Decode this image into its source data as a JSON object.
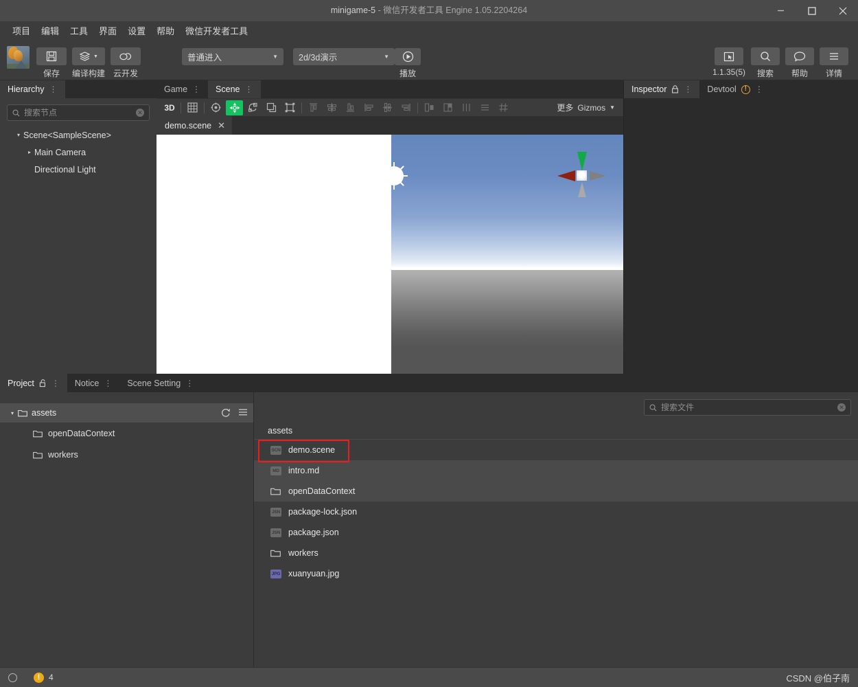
{
  "window": {
    "title_main": "minigame-5",
    "title_sep": "-",
    "title_sub": "微信开发者工具",
    "title_engine": "Engine 1.05.2204264",
    "minimize": "minimize-icon",
    "maximize": "maximize-icon",
    "close": "close-icon"
  },
  "menubar": {
    "items": [
      {
        "label": "项目"
      },
      {
        "label": "编辑"
      },
      {
        "label": "工具"
      },
      {
        "label": "界面"
      },
      {
        "label": "设置"
      },
      {
        "label": "帮助"
      },
      {
        "label": "微信开发者工具"
      }
    ]
  },
  "toolbar": {
    "project_thumb": "project-thumbnail",
    "save_label": "保存",
    "build_label": "编译构建",
    "cloud_label": "云开发",
    "enter_mode": "普通进入",
    "demo_mode": "2d/3d演示",
    "play_label": "播放",
    "version_label": "1.1.35(5)",
    "search_label": "搜索",
    "help_label": "帮助",
    "detail_label": "详情"
  },
  "hierarchy": {
    "tab_label": "Hierarchy",
    "search_placeholder": "搜索节点",
    "search_value": "",
    "nodes": [
      {
        "label": "Scene<SampleScene>",
        "depth": 0,
        "expanded": true,
        "arrow": "▾"
      },
      {
        "label": "Main Camera",
        "depth": 1,
        "expanded": false,
        "arrow": "▸"
      },
      {
        "label": "Directional Light",
        "depth": 1,
        "expanded": null,
        "arrow": ""
      }
    ]
  },
  "scene_panel": {
    "tabs": [
      {
        "label": "Game",
        "active": false
      },
      {
        "label": "Scene",
        "active": true
      }
    ],
    "toolbar_left": [
      {
        "name": "3d-toggle",
        "text": "3D",
        "active": false,
        "disabled": false
      },
      {
        "name": "grid-icon",
        "text": "",
        "active": false,
        "disabled": false
      },
      {
        "name": "pivot-icon",
        "text": "",
        "active": false,
        "disabled": false
      },
      {
        "name": "move-tool-icon",
        "text": "",
        "active": true,
        "disabled": false
      },
      {
        "name": "rotate-tool-icon",
        "text": "",
        "active": false,
        "disabled": false
      },
      {
        "name": "scale-tool-icon",
        "text": "",
        "active": false,
        "disabled": false
      },
      {
        "name": "rect-tool-icon",
        "text": "",
        "active": false,
        "disabled": false
      },
      {
        "name": "align-top-icon",
        "text": "",
        "active": false,
        "disabled": true
      },
      {
        "name": "align-center-v-icon",
        "text": "",
        "active": false,
        "disabled": true
      },
      {
        "name": "align-bottom-icon",
        "text": "",
        "active": false,
        "disabled": true
      },
      {
        "name": "align-left-icon",
        "text": "",
        "active": false,
        "disabled": true
      },
      {
        "name": "align-center-h-icon",
        "text": "",
        "active": false,
        "disabled": true
      },
      {
        "name": "align-right-icon",
        "text": "",
        "active": false,
        "disabled": true
      },
      {
        "name": "distribute-h-icon",
        "text": "",
        "active": false,
        "disabled": true
      },
      {
        "name": "distribute-v-icon",
        "text": "",
        "active": false,
        "disabled": true
      },
      {
        "name": "spacing-icon",
        "text": "",
        "active": false,
        "disabled": true
      },
      {
        "name": "list-icon",
        "text": "",
        "active": false,
        "disabled": true
      },
      {
        "name": "snap-grid-icon",
        "text": "",
        "active": false,
        "disabled": true
      }
    ],
    "more_label": "更多",
    "gizmos_label": "Gizmos",
    "file_tab": "demo.scene"
  },
  "inspector": {
    "tabs": [
      {
        "label": "Inspector",
        "active": true,
        "icon": "lock-icon"
      },
      {
        "label": "Devtool",
        "active": false,
        "icon": "warning-icon"
      }
    ]
  },
  "bottom_panel": {
    "tabs": [
      {
        "label": "Project",
        "active": true,
        "icon": "unlock-icon"
      },
      {
        "label": "Notice",
        "active": false,
        "icon": ""
      },
      {
        "label": "Scene Setting",
        "active": false,
        "icon": ""
      }
    ],
    "tree": {
      "root": {
        "label": "assets",
        "arrow": "▾"
      },
      "refresh_icon": "refresh-icon",
      "menu_icon": "hamburger-icon",
      "children": [
        {
          "label": "openDataContext",
          "icon": "folder-icon"
        },
        {
          "label": "workers",
          "icon": "folder-icon"
        }
      ]
    },
    "files": {
      "search_placeholder": "搜索文件",
      "search_value": "",
      "breadcrumb": "assets",
      "items": [
        {
          "name": "demo.scene",
          "type": "SCN",
          "kind": "file",
          "selected": true,
          "highlighted": false
        },
        {
          "name": "intro.md",
          "type": "MD",
          "kind": "file",
          "selected": false,
          "highlighted": true
        },
        {
          "name": "openDataContext",
          "type": "",
          "kind": "folder",
          "selected": false,
          "highlighted": true
        },
        {
          "name": "package-lock.json",
          "type": "JSN",
          "kind": "file",
          "selected": false,
          "highlighted": false
        },
        {
          "name": "package.json",
          "type": "JSN",
          "kind": "file",
          "selected": false,
          "highlighted": false
        },
        {
          "name": "workers",
          "type": "",
          "kind": "folder",
          "selected": false,
          "highlighted": false
        },
        {
          "name": "xuanyuan.jpg",
          "type": "JPG",
          "kind": "file",
          "selected": false,
          "highlighted": false
        }
      ]
    }
  },
  "statusbar": {
    "status_icon": "circle-icon",
    "warning_icon": "warning-icon",
    "warning_count": "4",
    "watermark": "CSDN @伯子南"
  },
  "colors": {
    "accent_green": "#16c260",
    "selection_red": "#ee1d1d",
    "warning_orange": "#f0a818",
    "panel_bg": "#3c3c3c",
    "window_bg": "#2b2b2b",
    "titlebar_bg": "#4a4a4a"
  }
}
